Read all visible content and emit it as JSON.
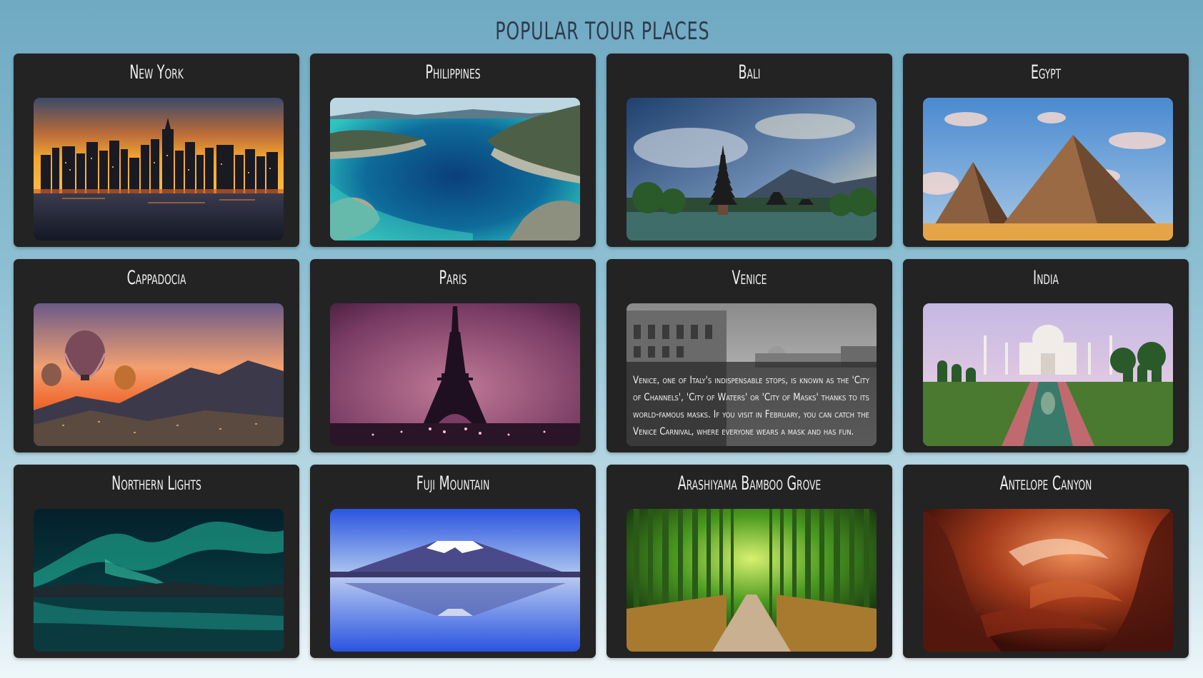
{
  "page": {
    "title": "POPULAR TOUR PLACES"
  },
  "places": [
    {
      "name": "New York",
      "image_icon": "new-york-skyline-image"
    },
    {
      "name": "Philippines",
      "image_icon": "philippines-lagoon-image"
    },
    {
      "name": "Bali",
      "image_icon": "bali-temple-image"
    },
    {
      "name": "Egypt",
      "image_icon": "egypt-pyramids-image"
    },
    {
      "name": "Cappadocia",
      "image_icon": "cappadocia-balloons-image"
    },
    {
      "name": "Paris",
      "image_icon": "paris-eiffel-tower-image"
    },
    {
      "name": "Venice",
      "image_icon": "venice-canal-image",
      "description": "Venice, one of Italy's indispensable stops, is known as the 'City of Channels', 'City of Waters' or 'City of Masks' thanks to its world-famous masks. If you visit in February, you can catch the Venice Carnival, where everyone wears a mask and has fun."
    },
    {
      "name": "India",
      "image_icon": "taj-mahal-image"
    },
    {
      "name": "Northern Lights",
      "image_icon": "aurora-image"
    },
    {
      "name": "Fuji Mountain",
      "image_icon": "mount-fuji-image"
    },
    {
      "name": "Arashiyama Bamboo Grove",
      "image_icon": "bamboo-grove-image"
    },
    {
      "name": "Antelope Canyon",
      "image_icon": "antelope-canyon-image"
    }
  ],
  "colors": {
    "card_background": "#232323",
    "title_color": "#2e3b4e",
    "card_title_color": "#f0f0f0"
  }
}
